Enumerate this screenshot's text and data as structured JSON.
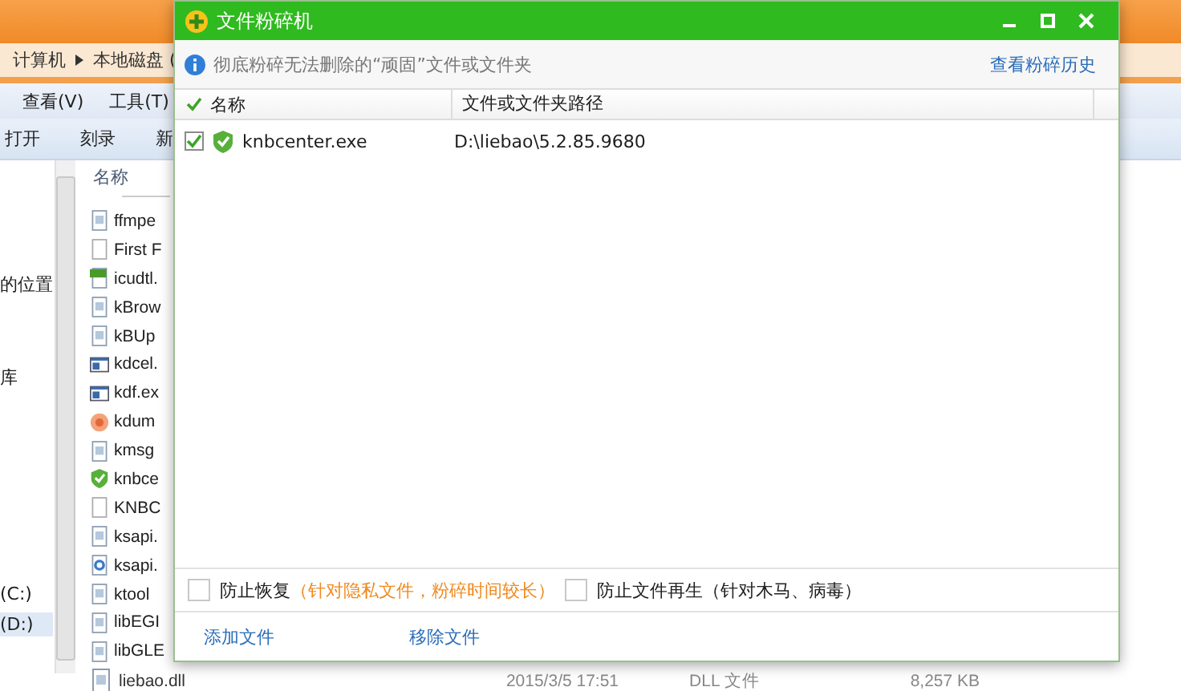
{
  "explorer": {
    "breadcrumb": [
      "计算机",
      "本地磁盘 ("
    ],
    "menu": [
      "查看(V)",
      "工具(T)"
    ],
    "toolbar": [
      "打开",
      "刻录",
      "新"
    ],
    "nav": [
      {
        "label": "的位置",
        "selected": false
      },
      {
        "label": "库",
        "selected": false
      },
      {
        "label": "(C:)",
        "selected": false
      },
      {
        "label": "(D:)",
        "selected": true
      }
    ],
    "list_header": "名称",
    "files": [
      {
        "name": "ffmpe",
        "kind": "doc"
      },
      {
        "name": "First F",
        "kind": "blank"
      },
      {
        "name": "icudtl.",
        "kind": "dat"
      },
      {
        "name": "kBrow",
        "kind": "doc"
      },
      {
        "name": "kBUp",
        "kind": "doc"
      },
      {
        "name": "kdcel.",
        "kind": "app"
      },
      {
        "name": "kdf.ex",
        "kind": "app"
      },
      {
        "name": "kdum",
        "kind": "disc"
      },
      {
        "name": "kmsg",
        "kind": "doc"
      },
      {
        "name": "knbce",
        "kind": "shield"
      },
      {
        "name": "KNBC",
        "kind": "blank"
      },
      {
        "name": "ksapi.",
        "kind": "doc"
      },
      {
        "name": "ksapi.",
        "kind": "gear"
      },
      {
        "name": "ktool",
        "kind": "doc"
      },
      {
        "name": "libEGI",
        "kind": "doc"
      },
      {
        "name": "libGLE",
        "kind": "doc"
      }
    ],
    "last_row": {
      "name": "liebao.dll",
      "date": "2015/3/5 17:51",
      "type": "DLL 文件",
      "size": "8,257 KB"
    }
  },
  "dialog": {
    "title": "文件粉碎机",
    "info": "彻底粉碎无法删除的“顽固”文件或文件夹",
    "history_link": "查看粉碎历史",
    "header_checked": true,
    "columns": [
      "名称",
      "文件或文件夹路径"
    ],
    "rows": [
      {
        "name": "knbcenter.exe",
        "path": "D:\\liebao\\5.2.85.9680",
        "checked": true
      }
    ],
    "options": [
      {
        "label": "防止恢复",
        "note": "（针对隐私文件，粉碎时间较长）",
        "note_highlighted": true,
        "checked": false
      },
      {
        "label": "防止文件再生",
        "note": "（针对木马、病毒）",
        "note_highlighted": false,
        "checked": false
      }
    ],
    "actions": [
      "添加文件",
      "移除文件"
    ]
  }
}
